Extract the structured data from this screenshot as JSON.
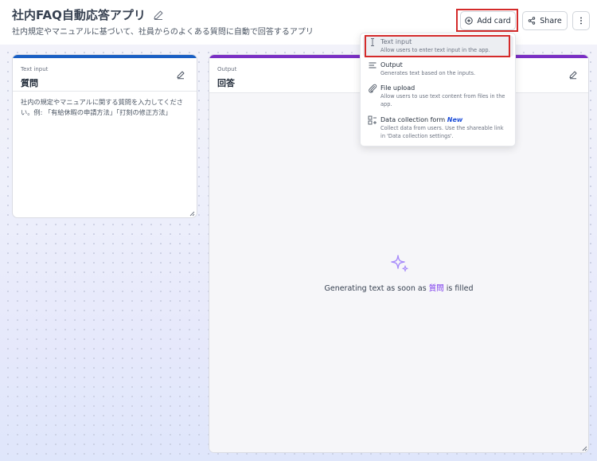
{
  "header": {
    "title": "社内FAQ自動応答アプリ",
    "subtitle": "社内規定やマニュアルに基づいて、社員からのよくある質問に自動で回答するアプリ",
    "add_card_label": "Add card",
    "share_label": "Share"
  },
  "input_card": {
    "type_label": "Text input",
    "title": "質問",
    "placeholder": "社内の規定やマニュアルに関する質問を入力してください。例: 「有給休暇の申請方法」「打刻の修正方法」"
  },
  "output_card": {
    "type_label": "Output",
    "title": "回答",
    "status_prefix": "Generating text as soon as",
    "status_ref": "質問",
    "status_suffix": "is filled"
  },
  "add_card_menu": {
    "items": [
      {
        "label": "Text input",
        "desc": "Allow users to enter text input in the app.",
        "icon": "text-cursor-icon"
      },
      {
        "label": "Output",
        "desc": "Generates text based on the inputs.",
        "icon": "lines-icon"
      },
      {
        "label": "File upload",
        "desc": "Allow users to use text content from files in the app.",
        "icon": "paperclip-icon"
      },
      {
        "label": "Data collection form",
        "badge": "New",
        "desc": "Collect data from users. Use the shareable link in 'Data collection settings'.",
        "icon": "form-icon"
      }
    ]
  },
  "colors": {
    "input_accent": "#1a5fc4",
    "output_accent": "#7a2fc4",
    "highlight_box": "#d42b2b",
    "new_badge": "#1d4ed8"
  }
}
